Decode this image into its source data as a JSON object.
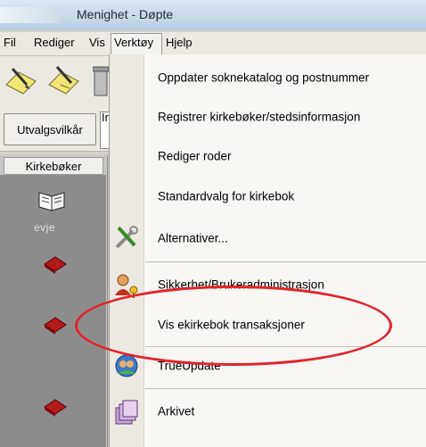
{
  "window": {
    "title": "Menighet - Døpte"
  },
  "menubar": {
    "items": [
      {
        "label": "Fil"
      },
      {
        "label": "Rediger"
      },
      {
        "label": "Vis"
      },
      {
        "label": "Verktøy"
      },
      {
        "label": "Hjelp"
      }
    ]
  },
  "filterbar": {
    "button_label": "Utvalgsvilkår",
    "field_label": "In"
  },
  "sidepane": {
    "header": "Kirkebøker",
    "item_label": "evje"
  },
  "dropdown": {
    "items": [
      {
        "label": "Oppdater soknekatalog og postnummer"
      },
      {
        "label": "Registrer kirkebøker/stedsinformasjon"
      },
      {
        "label": "Rediger roder"
      },
      {
        "label": "Standardvalg for kirkebok"
      },
      {
        "label": "Alternativer...",
        "icon": "tools-icon"
      },
      {
        "label": "Sikkerhet/Brukeradministrasjon",
        "icon": "users-key-icon"
      },
      {
        "label": "Vis ekirkebok transaksjoner"
      },
      {
        "label": "TrueUpdate",
        "icon": "trueupdate-icon"
      },
      {
        "label": "Arkivet",
        "icon": "archive-icon"
      }
    ]
  },
  "colors": {
    "highlight_ellipse": "#e3222a",
    "side_background": "#8c8c8c"
  }
}
